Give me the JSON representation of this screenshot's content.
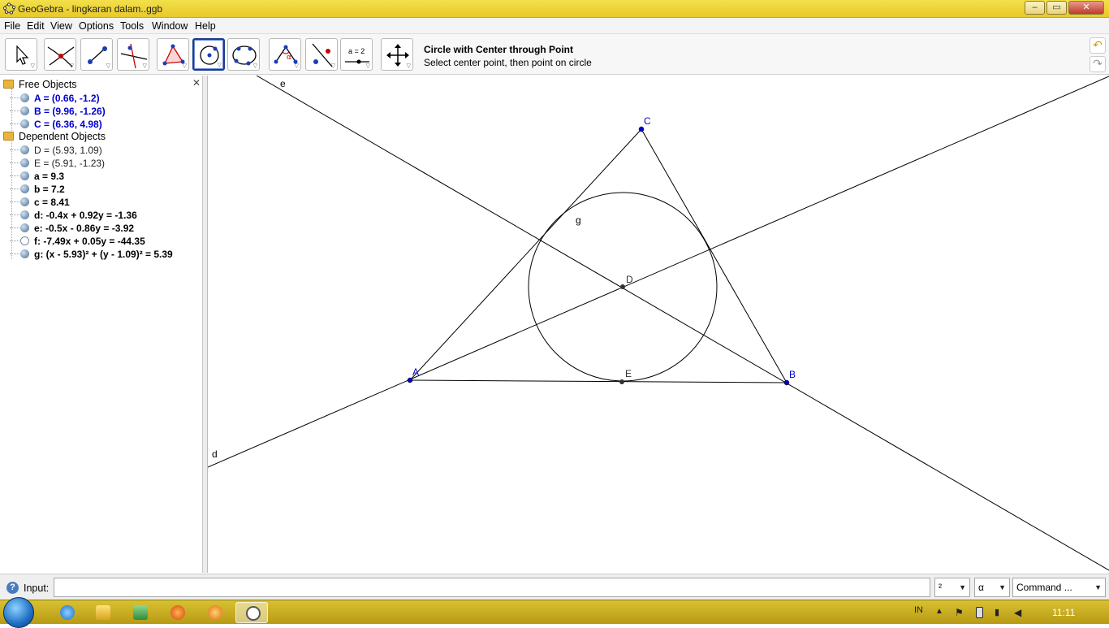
{
  "window": {
    "title": "GeoGebra - lingkaran dalam..ggb",
    "controls": {
      "minimize": "‒",
      "maximize": "▭",
      "close": "✕"
    }
  },
  "menu": [
    "File",
    "Edit",
    "View",
    "Options",
    "Tools",
    "Window",
    "Help"
  ],
  "toolbar": {
    "tools": [
      {
        "name": "move-tool",
        "icon": "cursor-arrow-icon"
      },
      {
        "name": "point-tool",
        "icon": "point-intersection-icon"
      },
      {
        "name": "line-tool",
        "icon": "line-through-points-icon"
      },
      {
        "name": "perpendicular-tool",
        "icon": "perpendicular-line-icon"
      },
      {
        "name": "polygon-tool",
        "icon": "polygon-icon"
      },
      {
        "name": "circle-tool",
        "icon": "circle-center-point-icon"
      },
      {
        "name": "conic-tool",
        "icon": "conic-five-points-icon"
      },
      {
        "name": "angle-tool",
        "icon": "angle-icon"
      },
      {
        "name": "reflect-tool",
        "icon": "reflect-about-line-icon"
      },
      {
        "name": "slider-tool",
        "icon": "slider-icon"
      },
      {
        "name": "move-graphics-tool",
        "icon": "move-graphics-view-icon"
      }
    ],
    "active_tool": "circle-tool",
    "slider_label": "a = 2",
    "description_title": "Circle with Center through Point",
    "description_hint": "Select center point, then point on circle"
  },
  "algebra": {
    "free_label": "Free Objects",
    "dependent_label": "Dependent Objects",
    "free": [
      {
        "text": "A = (0.66, -1.2)",
        "visible": true
      },
      {
        "text": "B = (9.96, -1.26)",
        "visible": true
      },
      {
        "text": "C = (6.36, 4.98)",
        "visible": true
      }
    ],
    "dependent": [
      {
        "text": "D = (5.93, 1.09)",
        "visible": true,
        "style": "dark"
      },
      {
        "text": "E = (5.91, -1.23)",
        "visible": true,
        "style": "dark"
      },
      {
        "text": "a = 9.3",
        "visible": true,
        "style": "bold"
      },
      {
        "text": "b = 7.2",
        "visible": true,
        "style": "bold"
      },
      {
        "text": "c = 8.41",
        "visible": true,
        "style": "bold"
      },
      {
        "text": "d: -0.4x + 0.92y = -1.36",
        "visible": true,
        "style": "bold"
      },
      {
        "text": "e: -0.5x - 0.86y = -3.92",
        "visible": true,
        "style": "bold"
      },
      {
        "text": "f: -7.49x + 0.05y = -44.35",
        "visible": false,
        "style": "bold"
      },
      {
        "text": "g: (x - 5.93)² + (y - 1.09)² = 5.39",
        "visible": true,
        "style": "bold"
      }
    ]
  },
  "graphics": {
    "labels": {
      "A": "A",
      "B": "B",
      "C": "C",
      "D": "D",
      "E": "E",
      "d": "d",
      "e": "e",
      "g": "g"
    },
    "colors": {
      "free_point": "#0000cc",
      "dependent_point": "#333333",
      "line": "#000000"
    }
  },
  "inputbar": {
    "label": "Input:",
    "value": "",
    "symbol_combo": "²",
    "greek_combo": "α",
    "command_combo": "Command ..."
  },
  "taskbar": {
    "apps": [
      "internet-explorer-icon",
      "file-explorer-icon",
      "spreadsheet-app-icon",
      "firefox-icon",
      "recycle-app-icon",
      "geogebra-icon"
    ],
    "language": "IN",
    "clock": "11:11"
  }
}
